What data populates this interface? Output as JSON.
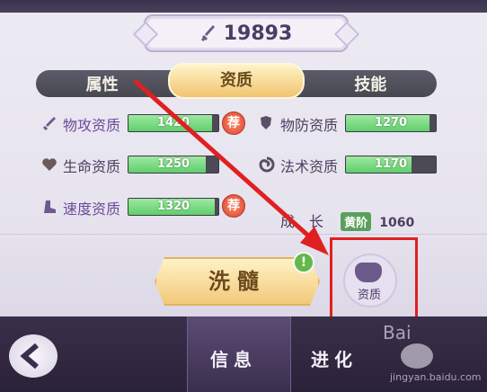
{
  "power": {
    "value": "19893"
  },
  "tabs": [
    {
      "label": "属性"
    },
    {
      "label": "资质"
    },
    {
      "label": "技能"
    }
  ],
  "stats": {
    "phys_attack": {
      "label": "物攻资质",
      "value": "1420",
      "fill": 0.93,
      "recommended": "荐"
    },
    "phys_defense": {
      "label": "物防资质",
      "value": "1270",
      "fill": 0.93
    },
    "hp": {
      "label": "生命资质",
      "value": "1250",
      "fill": 0.86
    },
    "magic": {
      "label": "法术资质",
      "value": "1170",
      "fill": 0.73
    },
    "speed": {
      "label": "速度资质",
      "value": "1320",
      "fill": 0.96,
      "recommended": "荐"
    }
  },
  "growth": {
    "label": "成　长",
    "tier": "黄阶",
    "value": "1060"
  },
  "actions": {
    "wash_label": "洗髓",
    "alert": "!",
    "zizhi_label": "资质"
  },
  "bottom_nav": {
    "info": "信息",
    "evolve": "进化",
    "watermark": "Bai",
    "watermark_url": "jingyan.baidu.com"
  },
  "colors": {
    "accent_red": "#e02020",
    "bar_green": "#5fcf6b",
    "tab_gold": "#f0c46e"
  }
}
